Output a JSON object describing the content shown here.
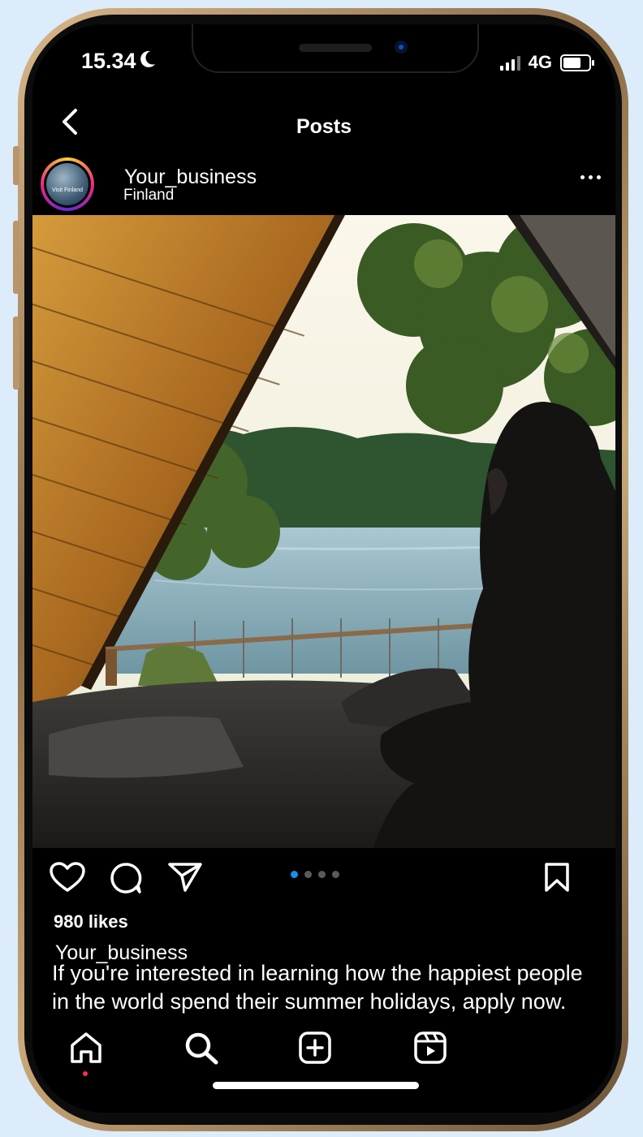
{
  "status_bar": {
    "time": "15.34",
    "network": "4G"
  },
  "nav": {
    "title": "Posts"
  },
  "post": {
    "username": "Your_business",
    "location": "Finland",
    "avatar_text": "Visit Finland",
    "likes": "980 likes",
    "caption_user": "Your_business",
    "caption": "If you're interested in learning how the happiest people in the world spend their summer holidays, apply now.",
    "carousel": {
      "count": 4,
      "active_index": 0
    }
  },
  "icons": {
    "back": "chevron-left-icon",
    "more": "more-horizontal-icon",
    "like": "heart-icon",
    "comment": "comment-icon",
    "share": "send-icon",
    "save": "bookmark-icon",
    "home": "home-icon",
    "search": "search-icon",
    "create": "plus-square-icon",
    "reels": "reels-icon"
  },
  "colors": {
    "accent_blue": "#1b8cf0",
    "notification_red": "#ff2d55",
    "background": "#000000",
    "page_background": "#dcecfb"
  }
}
